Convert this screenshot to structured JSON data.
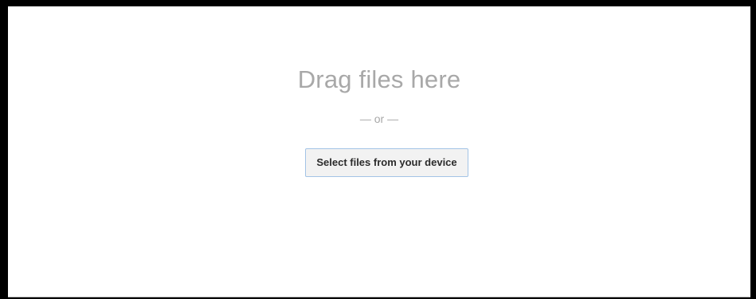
{
  "dropzone": {
    "title": "Drag files here",
    "or_text": "— or —",
    "select_button_label": "Select files from your device"
  },
  "colors": {
    "frame": "#000000",
    "background": "#ffffff",
    "muted_text": "#a8a8a8",
    "button_bg": "#f2f2f2",
    "button_border": "#a3c4e6",
    "button_text": "#2b2b2b"
  }
}
